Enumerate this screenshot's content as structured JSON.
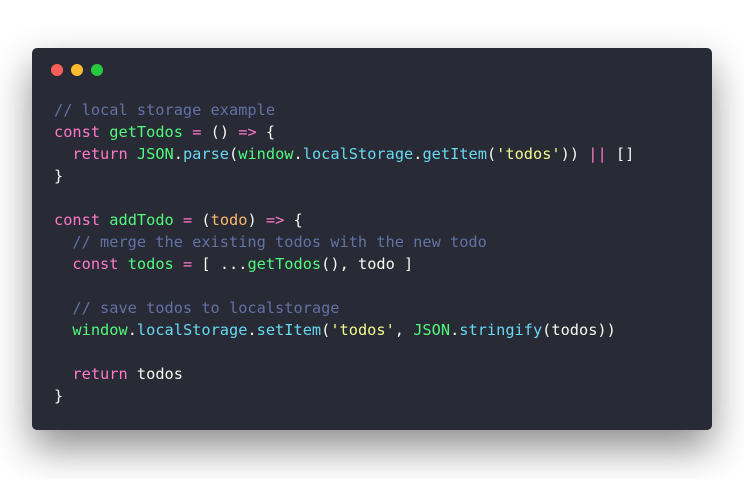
{
  "colors": {
    "page_background": "#ffffff",
    "window_background": "#282a36",
    "traffic_light_close": "#ff5f56",
    "traffic_light_minimize": "#ffbd2e",
    "traffic_light_maximize": "#27c93f",
    "comment": "#6272a4",
    "keyword": "#ff79c6",
    "function": "#50fa7b",
    "property": "#66d9ef",
    "string": "#f1fa8c",
    "text": "#f8f8f2"
  },
  "window": {
    "traffic_lights": [
      "close",
      "minimize",
      "maximize"
    ]
  },
  "code": {
    "lines": [
      [
        {
          "t": "// local storage example",
          "k": "comment"
        }
      ],
      [
        {
          "t": "const",
          "k": "keyword"
        },
        {
          "t": " ",
          "k": "punct"
        },
        {
          "t": "getTodos",
          "k": "function"
        },
        {
          "t": " ",
          "k": "punct"
        },
        {
          "t": "=",
          "k": "operator"
        },
        {
          "t": " () ",
          "k": "punct"
        },
        {
          "t": "=>",
          "k": "operator"
        },
        {
          "t": " {",
          "k": "punct"
        }
      ],
      [
        {
          "t": "  ",
          "k": "punct"
        },
        {
          "t": "return",
          "k": "keyword"
        },
        {
          "t": " ",
          "k": "punct"
        },
        {
          "t": "JSON",
          "k": "global"
        },
        {
          "t": ".",
          "k": "punct"
        },
        {
          "t": "parse",
          "k": "property"
        },
        {
          "t": "(",
          "k": "punct"
        },
        {
          "t": "window",
          "k": "global"
        },
        {
          "t": ".",
          "k": "punct"
        },
        {
          "t": "localStorage",
          "k": "property"
        },
        {
          "t": ".",
          "k": "punct"
        },
        {
          "t": "getItem",
          "k": "property"
        },
        {
          "t": "(",
          "k": "punct"
        },
        {
          "t": "'todos'",
          "k": "string"
        },
        {
          "t": ")) ",
          "k": "punct"
        },
        {
          "t": "||",
          "k": "operator"
        },
        {
          "t": " []",
          "k": "punct"
        }
      ],
      [
        {
          "t": "}",
          "k": "punct"
        }
      ],
      [],
      [
        {
          "t": "const",
          "k": "keyword"
        },
        {
          "t": " ",
          "k": "punct"
        },
        {
          "t": "addTodo",
          "k": "function"
        },
        {
          "t": " ",
          "k": "punct"
        },
        {
          "t": "=",
          "k": "operator"
        },
        {
          "t": " (",
          "k": "punct"
        },
        {
          "t": "todo",
          "k": "param"
        },
        {
          "t": ") ",
          "k": "punct"
        },
        {
          "t": "=>",
          "k": "operator"
        },
        {
          "t": " {",
          "k": "punct"
        }
      ],
      [
        {
          "t": "  // merge the existing todos with the new todo",
          "k": "comment"
        }
      ],
      [
        {
          "t": "  ",
          "k": "punct"
        },
        {
          "t": "const",
          "k": "keyword"
        },
        {
          "t": " ",
          "k": "punct"
        },
        {
          "t": "todos",
          "k": "global"
        },
        {
          "t": " ",
          "k": "punct"
        },
        {
          "t": "=",
          "k": "operator"
        },
        {
          "t": " [ ...",
          "k": "punct"
        },
        {
          "t": "getTodos",
          "k": "function"
        },
        {
          "t": "(), todo ]",
          "k": "punct"
        }
      ],
      [],
      [
        {
          "t": "  // save todos to localstorage",
          "k": "comment"
        }
      ],
      [
        {
          "t": "  ",
          "k": "punct"
        },
        {
          "t": "window",
          "k": "global"
        },
        {
          "t": ".",
          "k": "punct"
        },
        {
          "t": "localStorage",
          "k": "property"
        },
        {
          "t": ".",
          "k": "punct"
        },
        {
          "t": "setItem",
          "k": "property"
        },
        {
          "t": "(",
          "k": "punct"
        },
        {
          "t": "'todos'",
          "k": "string"
        },
        {
          "t": ", ",
          "k": "punct"
        },
        {
          "t": "JSON",
          "k": "global"
        },
        {
          "t": ".",
          "k": "punct"
        },
        {
          "t": "stringify",
          "k": "property"
        },
        {
          "t": "(todos))",
          "k": "punct"
        }
      ],
      [],
      [
        {
          "t": "  ",
          "k": "punct"
        },
        {
          "t": "return",
          "k": "keyword"
        },
        {
          "t": " todos",
          "k": "punct"
        }
      ],
      [
        {
          "t": "}",
          "k": "punct"
        }
      ]
    ]
  }
}
